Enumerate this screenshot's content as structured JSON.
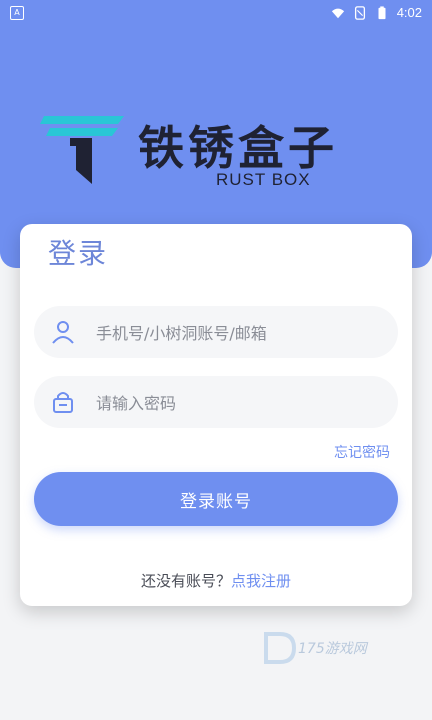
{
  "status_bar": {
    "left_icon": "A",
    "time": "4:02",
    "icons": [
      "wifi-icon",
      "sim-icon",
      "battery-icon"
    ]
  },
  "logo": {
    "title": "铁锈盒子",
    "subtitle": "RUST BOX"
  },
  "login_card": {
    "title": "登录",
    "phone_placeholder": "手机号/小树洞账号/邮箱",
    "password_placeholder": "请输入密码",
    "forgot_password": "忘记密码",
    "login_button": "登录账号",
    "register_prompt": "还没有账号？",
    "register_link": "点我注册"
  },
  "watermark": {
    "text": "175游戏网"
  },
  "colors": {
    "primary": "#6f8ff0",
    "title": "#6d86d8",
    "logo_teal": "#29c6d6",
    "logo_dark": "#1f2233"
  }
}
